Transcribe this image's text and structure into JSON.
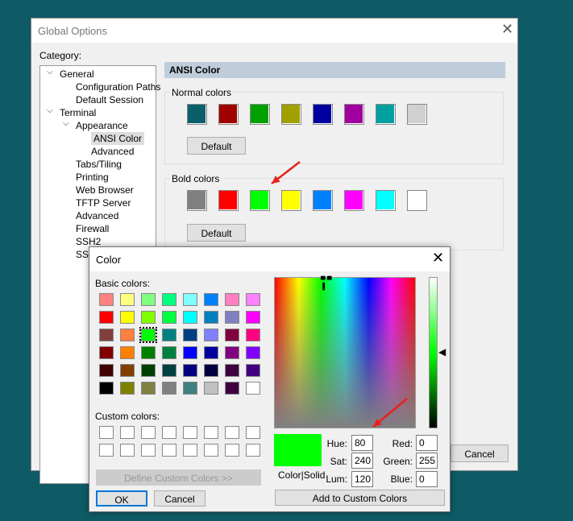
{
  "global_options": {
    "title": "Global Options",
    "category_label": "Category:",
    "cancel_label": "Cancel",
    "tree": [
      {
        "label": "General",
        "level": 0,
        "expanded": true
      },
      {
        "label": "Configuration Paths",
        "level": 2
      },
      {
        "label": "Default Session",
        "level": 2
      },
      {
        "label": "Terminal",
        "level": 0,
        "expanded": true
      },
      {
        "label": "Appearance",
        "level": 1,
        "expanded": true
      },
      {
        "label": "ANSI Color",
        "level": 3,
        "selected": true
      },
      {
        "label": "Advanced",
        "level": 3
      },
      {
        "label": "Tabs/Tiling",
        "level": 2
      },
      {
        "label": "Printing",
        "level": 2
      },
      {
        "label": "Web Browser",
        "level": 2
      },
      {
        "label": "TFTP Server",
        "level": 2
      },
      {
        "label": "Advanced",
        "level": 2
      },
      {
        "label": "Firewall",
        "level": 1
      },
      {
        "label": "SSH2",
        "level": 1
      },
      {
        "label": "SSH Ho",
        "level": 1
      }
    ],
    "panel_title": "ANSI Color",
    "normal": {
      "label": "Normal colors",
      "default_label": "Default",
      "colors": [
        "#0a5f6a",
        "#a00000",
        "#00a000",
        "#a0a000",
        "#0000a0",
        "#a000a0",
        "#00a0a0",
        "#d0d0d0"
      ]
    },
    "bold": {
      "label": "Bold colors",
      "default_label": "Default",
      "colors": [
        "#808080",
        "#ff0000",
        "#00ff00",
        "#ffff00",
        "#0080ff",
        "#ff00ff",
        "#00ffff",
        "#ffffff"
      ]
    }
  },
  "color_dialog": {
    "title": "Color",
    "basic_label": "Basic colors:",
    "custom_label": "Custom colors:",
    "basic_colors": [
      "#ff8080",
      "#ffff80",
      "#80ff80",
      "#00ff80",
      "#80ffff",
      "#0080ff",
      "#ff80c0",
      "#ff80ff",
      "#ff0000",
      "#ffff00",
      "#80ff00",
      "#00ff40",
      "#00ffff",
      "#0080c0",
      "#8080c0",
      "#ff00ff",
      "#804040",
      "#ff8040",
      "#00ff00",
      "#008080",
      "#004080",
      "#8080ff",
      "#800040",
      "#ff0080",
      "#800000",
      "#ff8000",
      "#008000",
      "#008040",
      "#0000ff",
      "#0000a0",
      "#800080",
      "#8000ff",
      "#400000",
      "#804000",
      "#004000",
      "#004040",
      "#000080",
      "#000040",
      "#400040",
      "#400080",
      "#000000",
      "#808000",
      "#808040",
      "#808080",
      "#408080",
      "#c0c0c0",
      "#400040",
      "#ffffff"
    ],
    "selected_basic_index": 18,
    "define_custom_label": "Define Custom Colors >>",
    "ok_label": "OK",
    "cancel_label": "Cancel",
    "preview_label": "Color|Solid",
    "preview_color": "#00ff00",
    "hue_label": "Hue:",
    "hue": "80",
    "sat_label": "Sat:",
    "sat": "240",
    "lum_label": "Lum:",
    "lum": "120",
    "red_label": "Red:",
    "red": "0",
    "green_label": "Green:",
    "green": "255",
    "blue_label": "Blue:",
    "blue": "0",
    "add_custom_label": "Add to Custom Colors"
  },
  "annotation_color": "#e8201c"
}
